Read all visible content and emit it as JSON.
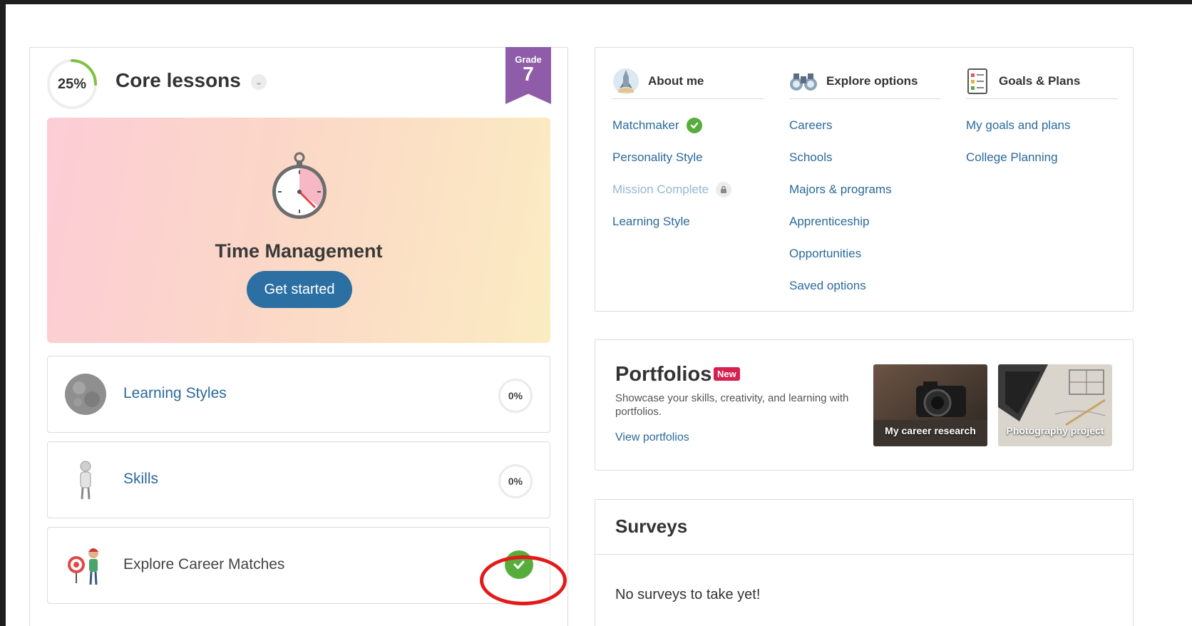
{
  "core": {
    "progress_text": "25%",
    "progress_fraction": 0.25,
    "title": "Core lessons",
    "grade_label": "Grade",
    "grade_value": "7",
    "hero": {
      "title": "Time Management",
      "button_label": "Get started"
    },
    "lessons": [
      {
        "label": "Learning Styles",
        "progress": "0%",
        "status": "not-started",
        "icon": "globe-icon"
      },
      {
        "label": "Skills",
        "progress": "0%",
        "status": "not-started",
        "icon": "character-icon"
      },
      {
        "label": "Explore Career Matches",
        "status": "complete",
        "icon": "target-person-icon"
      }
    ]
  },
  "nav": {
    "about_me": {
      "title": "About me",
      "icon": "rocket-icon",
      "items": [
        {
          "label": "Matchmaker",
          "state": "complete"
        },
        {
          "label": "Personality Style",
          "state": "available"
        },
        {
          "label": "Mission Complete",
          "state": "locked"
        },
        {
          "label": "Learning Style",
          "state": "available"
        }
      ]
    },
    "explore": {
      "title": "Explore options",
      "icon": "binoculars-icon",
      "items": [
        "Careers",
        "Schools",
        "Majors & programs",
        "Apprenticeship",
        "Opportunities",
        "Saved options"
      ]
    },
    "goals": {
      "title": "Goals & Plans",
      "icon": "checklist-icon",
      "items": [
        "My goals and plans",
        "College Planning"
      ]
    }
  },
  "portfolios": {
    "title": "Portfolios",
    "badge": "New",
    "description": "Showcase your skills, creativity, and learning with portfolios.",
    "link": "View portfolios",
    "thumbs": [
      {
        "caption": "My career research"
      },
      {
        "caption": "Photography project"
      }
    ]
  },
  "surveys": {
    "title": "Surveys",
    "empty_message": "No surveys to take yet!"
  },
  "colors": {
    "accent_blue": "#2c6fa3",
    "link_blue": "#2b6a9c",
    "grade_purple": "#8e5ca8",
    "success_green": "#57ad3c",
    "progress_green": "#7cc243",
    "badge_red": "#d6204f",
    "annotation_red": "#e21a1a"
  }
}
